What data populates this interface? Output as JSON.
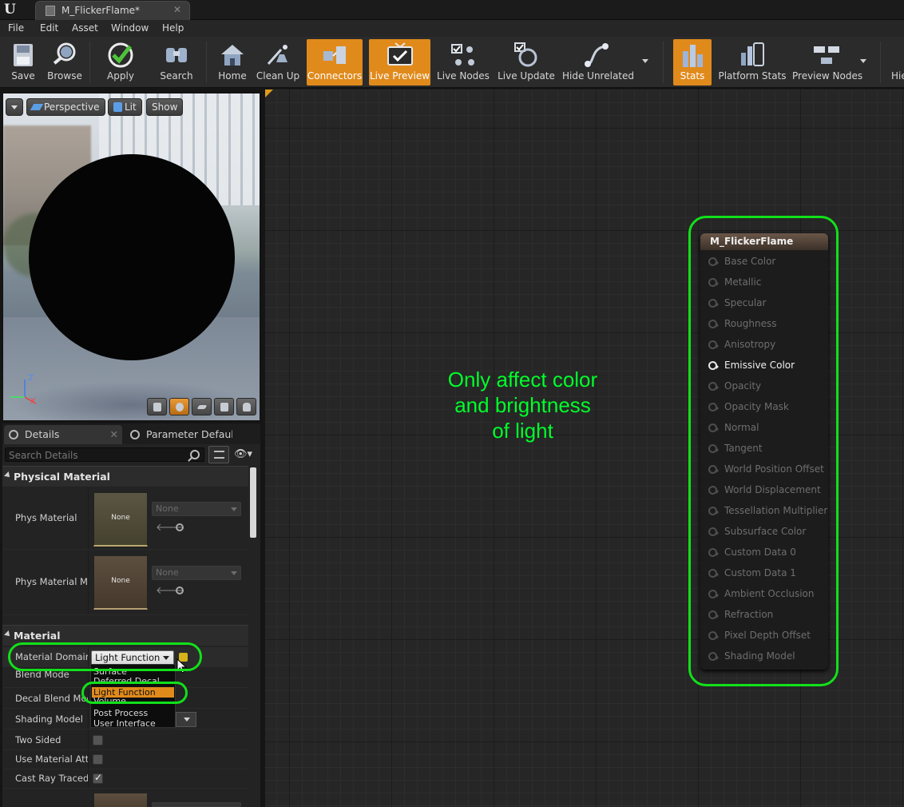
{
  "window": {
    "tab_title": "M_FlickerFlame*",
    "close_glyph": "✕",
    "logo": "U"
  },
  "menu": [
    "File",
    "Edit",
    "Asset",
    "Window",
    "Help"
  ],
  "toolbar": {
    "buttons": [
      {
        "label": "Save",
        "icon": "save-icon",
        "active": false
      },
      {
        "label": "Browse",
        "icon": "browse-icon",
        "active": false
      },
      {
        "label": "Apply",
        "icon": "apply-icon",
        "active": false
      },
      {
        "label": "Search",
        "icon": "search-binoculars-icon",
        "active": false
      },
      {
        "label": "Home",
        "icon": "home-icon",
        "active": false
      },
      {
        "label": "Clean Up",
        "icon": "clean-up-icon",
        "active": false
      },
      {
        "label": "Connectors",
        "icon": "connectors-icon",
        "active": true
      },
      {
        "label": "Live Preview",
        "icon": "live-preview-icon",
        "active": true
      },
      {
        "label": "Live Nodes",
        "icon": "live-nodes-icon",
        "active": false
      },
      {
        "label": "Live Update",
        "icon": "live-update-icon",
        "active": false
      },
      {
        "label": "Hide Unrelated",
        "icon": "hide-unrelated-icon",
        "active": false
      },
      {
        "label": "Stats",
        "icon": "stats-icon",
        "active": true
      },
      {
        "label": "Platform Stats",
        "icon": "platform-stats-icon",
        "active": false
      },
      {
        "label": "Preview Nodes",
        "icon": "preview-nodes-icon",
        "active": false
      },
      {
        "label": "Hie",
        "icon": "hierarchy-icon",
        "active": false
      }
    ],
    "active_color": "#e08a1c"
  },
  "viewport": {
    "buttons": {
      "perspective": "Perspective",
      "lit": "Lit",
      "show": "Show"
    },
    "axis": {
      "z": "Z",
      "x": "X"
    }
  },
  "details": {
    "tabs": {
      "details": "Details",
      "close": "✕",
      "parameters": "Parameter Defaults"
    },
    "search_placeholder": "Search Details",
    "eye_glyph": "👁▾",
    "categories": {
      "physical": "Physical Material",
      "material": "Material"
    },
    "physical": {
      "phys_material": {
        "label": "Phys Material",
        "thumb": "None",
        "value": "None"
      },
      "phys_material_mask": {
        "label": "Phys Material Mask",
        "thumb": "None",
        "value": "None"
      },
      "arrow_glyph": "🡐"
    },
    "material": {
      "material_domain": {
        "label": "Material Domain",
        "value": "Light Function"
      },
      "blend_mode": {
        "label": "Blend Mode"
      },
      "decal_blend_mode": {
        "label": "Decal Blend Mode"
      },
      "shading_model": {
        "label": "Shading Model"
      },
      "two_sided": {
        "label": "Two Sided",
        "checked": false
      },
      "use_material_attributes": {
        "label": "Use Material Attributes",
        "checked": false
      },
      "cast_ray_traced_shadows": {
        "label": "Cast Ray Traced Shadows",
        "checked": true
      }
    },
    "domain_options": [
      "Surface",
      "Deferred Decal",
      "Light Function",
      "Volume",
      "Post Process",
      "User Interface"
    ],
    "selected_option": "Light Function"
  },
  "graph": {
    "annotation": [
      "Only affect color",
      "and brightness",
      "of light"
    ],
    "annotation_color": "#00ff2a",
    "node": {
      "title": "M_FlickerFlame",
      "pins": [
        "Base Color",
        "Metallic",
        "Specular",
        "Roughness",
        "Anisotropy",
        "Emissive Color",
        "Opacity",
        "Opacity Mask",
        "Normal",
        "Tangent",
        "World Position Offset",
        "World Displacement",
        "Tessellation Multiplier",
        "Subsurface Color",
        "Custom Data 0",
        "Custom Data 1",
        "Ambient Occlusion",
        "Refraction",
        "Pixel Depth Offset",
        "Shading Model"
      ],
      "active_pin": "Emissive Color"
    }
  },
  "highlight_color": "#12e01a"
}
